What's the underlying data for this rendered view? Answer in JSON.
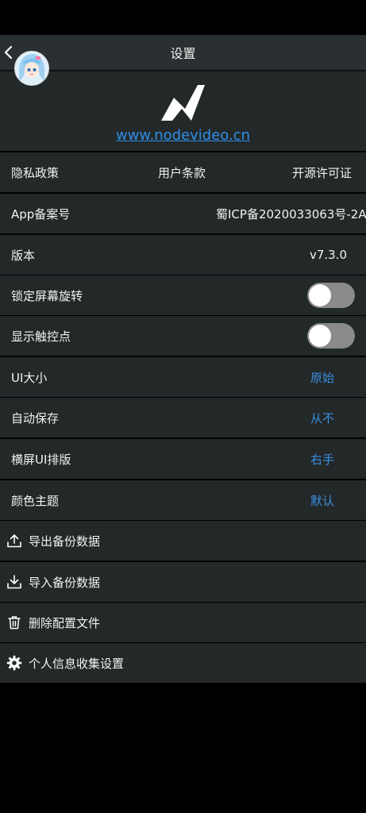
{
  "header": {
    "title": "设置"
  },
  "logo": {
    "link": "www.nodevideo.cn"
  },
  "links_row": {
    "privacy": "隐私政策",
    "terms": "用户条款",
    "opensource": "开源许可证"
  },
  "icp": {
    "label": "App备案号",
    "value": "蜀ICP备2020033063号-2A"
  },
  "version": {
    "label": "版本",
    "value": "v7.3.0"
  },
  "settings": {
    "lock_rotation": {
      "label": "锁定屏幕旋转",
      "enabled": false
    },
    "show_touches": {
      "label": "显示触控点",
      "enabled": false
    },
    "ui_size": {
      "label": "UI大小",
      "value": "原始"
    },
    "autosave": {
      "label": "自动保存",
      "value": "从不"
    },
    "landscape_layout": {
      "label": "横屏UI排版",
      "value": "右手"
    },
    "theme": {
      "label": "颜色主题",
      "value": "默认"
    }
  },
  "actions": {
    "export": {
      "label": "导出备份数据",
      "icon": "upload-icon"
    },
    "import": {
      "label": "导入备份数据",
      "icon": "download-icon"
    },
    "delete": {
      "label": "删除配置文件",
      "icon": "trash-icon"
    },
    "privacy_settings": {
      "label": "个人信息收集设置",
      "icon": "gear-icon"
    }
  },
  "colors": {
    "accent": "#3b8fe0",
    "link": "#2f8fe8",
    "row_bg": "#232829",
    "header_bg": "#2a2f31"
  }
}
